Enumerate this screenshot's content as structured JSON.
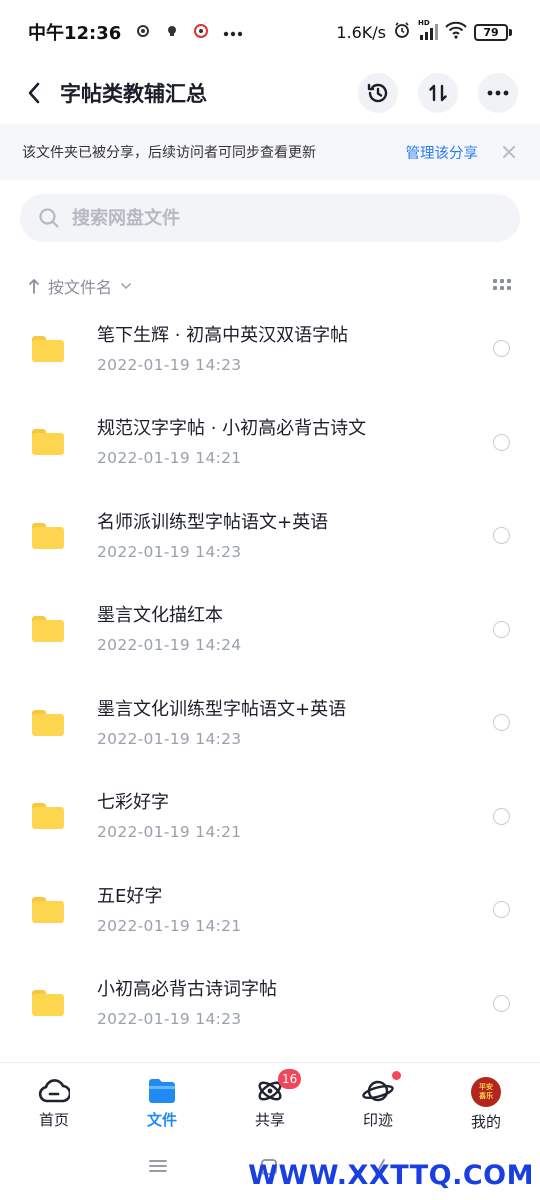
{
  "status_bar": {
    "time": "中午12:36",
    "network_speed": "1.6K/s",
    "battery": "79",
    "hd_label": "HD"
  },
  "header": {
    "title": "字帖类教辅汇总"
  },
  "notice": {
    "text": "该文件夹已被分享，后续访问者可同步查看更新",
    "link": "管理该分享"
  },
  "search": {
    "placeholder": "搜索网盘文件"
  },
  "sort": {
    "label": "按文件名"
  },
  "files": [
    {
      "name": "笔下生辉 · 初高中英汉双语字帖",
      "time": "2022-01-19  14:23"
    },
    {
      "name": "规范汉字字帖 · 小初高必背古诗文",
      "time": "2022-01-19  14:21"
    },
    {
      "name": "名师派训练型字帖语文+英语",
      "time": "2022-01-19  14:23"
    },
    {
      "name": "墨言文化描红本",
      "time": "2022-01-19  14:24"
    },
    {
      "name": "墨言文化训练型字帖语文+英语",
      "time": "2022-01-19  14:23"
    },
    {
      "name": "七彩好字",
      "time": "2022-01-19  14:21"
    },
    {
      "name": "五E好字",
      "time": "2022-01-19  14:21"
    },
    {
      "name": "小初高必背古诗词字帖",
      "time": "2022-01-19  14:23"
    }
  ],
  "bottom_nav": [
    {
      "label": "首页",
      "icon": "cloud-home-icon"
    },
    {
      "label": "文件",
      "icon": "folder-icon",
      "active": true
    },
    {
      "label": "共享",
      "icon": "atom-share-icon",
      "badge": "16"
    },
    {
      "label": "印迹",
      "icon": "planet-icon",
      "dot": true
    },
    {
      "label": "我的",
      "icon": "avatar-icon",
      "avatar_text": "平安喜乐"
    }
  ],
  "watermark": "WWW.XXTTQ.COM",
  "colors": {
    "accent": "#1f8bf3",
    "link": "#2f7cf6",
    "folder": "#fdd54f",
    "badge": "#f0475a"
  }
}
